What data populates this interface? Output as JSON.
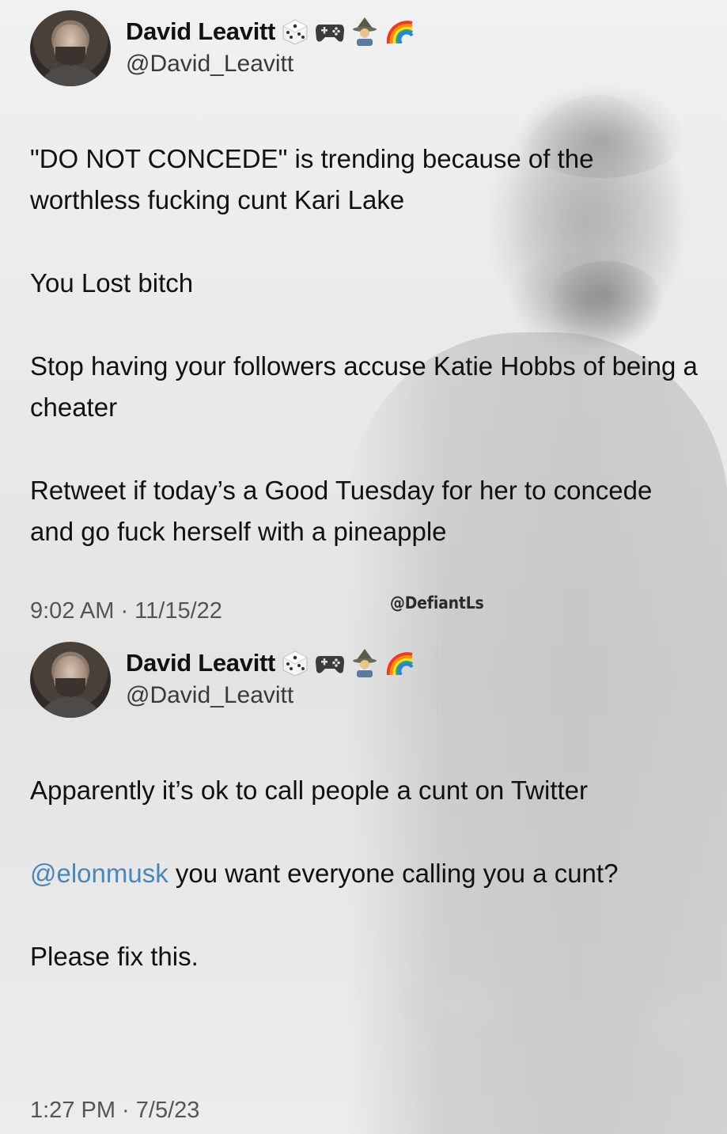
{
  "tweets": [
    {
      "display_name": "David Leavitt",
      "handle": "@David_Leavitt",
      "emojis": [
        "game-die-icon",
        "video-game-icon",
        "mage-icon",
        "rainbow-icon"
      ],
      "paragraphs": [
        "\"DO NOT CONCEDE\" is trending because of the worthless fucking cunt Kari Lake",
        "You Lost bitch",
        "Stop having your followers accuse Katie Hobbs of being a cheater",
        "Retweet if today’s a Good Tuesday for her to concede and go fuck herself with a pineapple"
      ],
      "timestamp": "9:02 AM · 11/15/22"
    },
    {
      "display_name": "David Leavitt",
      "handle": "@David_Leavitt",
      "emojis": [
        "game-die-icon",
        "video-game-icon",
        "mage-icon",
        "rainbow-icon"
      ],
      "paragraphs": [
        "Apparently it’s ok to call people a cunt on Twitter",
        "you want everyone calling you a cunt?",
        "Please fix this."
      ],
      "mention": "@elonmusk",
      "timestamp": "1:27 PM · 7/5/23"
    }
  ],
  "watermark": "@DefiantLs",
  "colors": {
    "mention": "#4a86b8",
    "text": "#111111",
    "muted": "#555555"
  }
}
